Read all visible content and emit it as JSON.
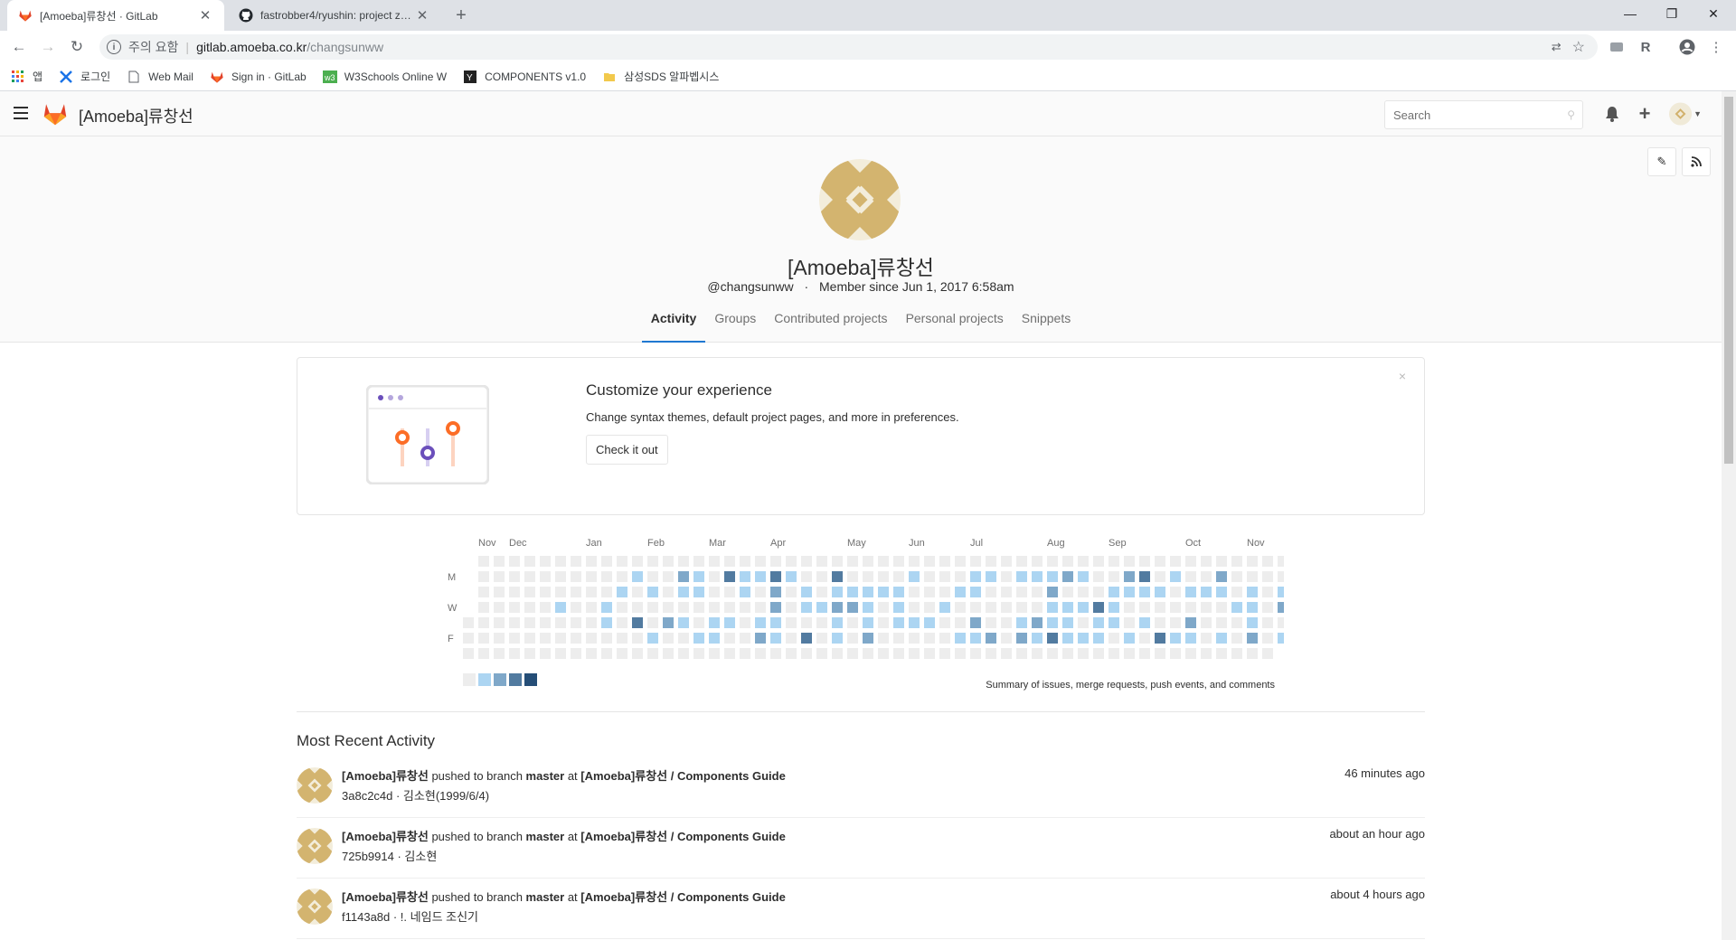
{
  "browser": {
    "tabs": [
      {
        "title": "[Amoeba]류창선 · GitLab",
        "active": true
      },
      {
        "title": "fastrobber4/ryushin: project zero",
        "active": false
      }
    ],
    "address": {
      "security_label": "주의 요함",
      "host": "gitlab.amoeba.co.kr",
      "path": "/changsunww"
    },
    "bookmarks": [
      {
        "label": "앱",
        "icon": "apps-grid-icon"
      },
      {
        "label": "로그인",
        "icon": "tool-icon"
      },
      {
        "label": "Web Mail",
        "icon": "page-icon"
      },
      {
        "label": "Sign in · GitLab",
        "icon": "gitlab-icon"
      },
      {
        "label": "W3Schools Online W",
        "icon": "w3schools-icon"
      },
      {
        "label": "COMPONENTS v1.0",
        "icon": "y-icon"
      },
      {
        "label": "삼성SDS 알파벱시스",
        "icon": "folder-icon"
      }
    ]
  },
  "gitlab_header": {
    "title": "[Amoeba]류창선",
    "search_placeholder": "Search"
  },
  "profile": {
    "name": "[Amoeba]류창선",
    "username": "@changsunww",
    "member_since": "Member since Jun 1, 2017 6:58am",
    "tabs": [
      "Activity",
      "Groups",
      "Contributed projects",
      "Personal projects",
      "Snippets"
    ],
    "active_tab": "Activity"
  },
  "promo": {
    "title": "Customize your experience",
    "text": "Change syntax themes, default project pages, and more in preferences.",
    "button": "Check it out",
    "close": "×"
  },
  "calendar": {
    "months": [
      "Nov",
      "Dec",
      "Jan",
      "Feb",
      "Mar",
      "Apr",
      "May",
      "Jun",
      "Jul",
      "Aug",
      "Sep",
      "Oct",
      "Nov"
    ],
    "day_labels": [
      "M",
      "W",
      "F"
    ],
    "summary": "Summary of issues, merge requests, push events, and comments",
    "colors": [
      "#ededed",
      "#acd5f2",
      "#7fa8c9",
      "#527ba0",
      "#254e77"
    ]
  },
  "recent": {
    "title": "Most Recent Activity",
    "events": [
      {
        "author": "[Amoeba]류창선",
        "action": "pushed to branch",
        "branch": "master",
        "at": "at",
        "project": "[Amoeba]류창선 / Components Guide",
        "commit": "3a8c2c4d · 김소현(1999/6/4)",
        "time": "46 minutes ago"
      },
      {
        "author": "[Amoeba]류창선",
        "action": "pushed to branch",
        "branch": "master",
        "at": "at",
        "project": "[Amoeba]류창선 / Components Guide",
        "commit": "725b9914 · 김소현",
        "time": "about an hour ago"
      },
      {
        "author": "[Amoeba]류창선",
        "action": "pushed to branch",
        "branch": "master",
        "at": "at",
        "project": "[Amoeba]류창선 / Components Guide",
        "commit": "f1143a8d · !. 네임드 조신기",
        "time": "about 4 hours ago"
      }
    ]
  }
}
